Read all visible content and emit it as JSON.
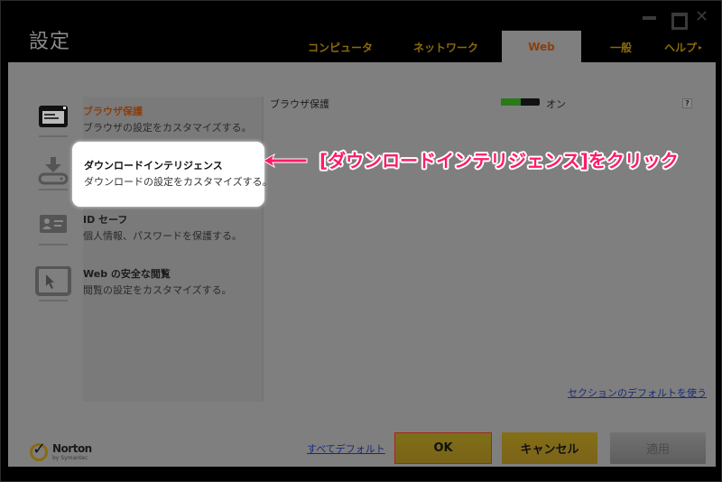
{
  "window": {
    "title": "設定",
    "controls": [
      "minimize-icon",
      "maximize-icon",
      "close-icon"
    ]
  },
  "tabs": [
    {
      "label": "コンピュータ",
      "active": false
    },
    {
      "label": "ネットワーク",
      "active": false
    },
    {
      "label": "Web",
      "active": true
    },
    {
      "label": "一般",
      "active": false
    },
    {
      "label": "ヘルプ",
      "active": false,
      "arrow": "▸"
    }
  ],
  "sidebar": {
    "items": [
      {
        "title": "ブラウザ保護",
        "desc": "ブラウザの設定をカスタマイズする。",
        "icon": "browser-window-icon",
        "selected": true
      },
      {
        "title": "ダウンロードインテリジェンス",
        "desc": "ダウンロードの設定をカスタマイズする。",
        "icon": "download-icon",
        "highlighted": true
      },
      {
        "title": "ID セーフ",
        "desc": "個人情報、パスワードを保護する。",
        "icon": "id-card-icon"
      },
      {
        "title": "Web の安全な閲覧",
        "desc": "閲覧の設定をカスタマイズする。",
        "icon": "cursor-window-icon"
      }
    ]
  },
  "settings": [
    {
      "label": "ブラウザ保護",
      "state": "オン",
      "toggle_on_fraction": 0.5,
      "help": "?"
    }
  ],
  "annotation": {
    "text": "[ダウンロードインテリジェンス]をクリック",
    "color": "#ff1a6a"
  },
  "links": {
    "section_default": "セクションのデフォルトを使う",
    "all_default": "すべてデフォルト"
  },
  "buttons": {
    "ok": "OK",
    "cancel": "キャンセル",
    "apply": "適用"
  },
  "logo": {
    "name": "Norton",
    "sub": "by Symantec"
  }
}
